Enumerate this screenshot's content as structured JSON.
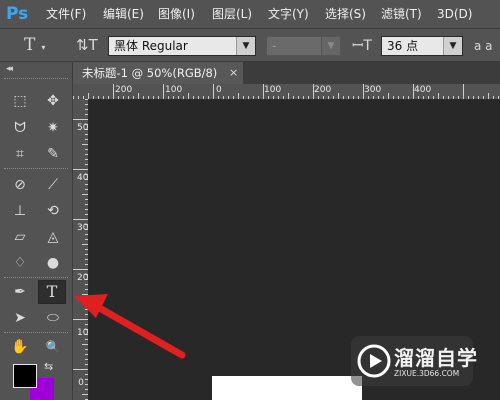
{
  "app": {
    "logo": "Ps",
    "menus": [
      "文件(F)",
      "编辑(E)",
      "图像(I)",
      "图层(L)",
      "文字(Y)",
      "选择(S)",
      "滤镜(T)",
      "3D(D)"
    ]
  },
  "options_bar": {
    "tool_icon": "text-tool-icon",
    "orientation_icon": "text-orientation-icon",
    "font_family": "黑体 Regular",
    "font_style": "-",
    "font_size_icon": "font-size-icon",
    "font_size": "36 点",
    "antialias_label": "a a"
  },
  "toolbar": {
    "collapse_glyph": "◂◂",
    "tools": [
      {
        "name": "rectangular-marquee-tool",
        "glyph": "⬚",
        "active": false
      },
      {
        "name": "move-tool",
        "glyph": "✥",
        "active": false
      },
      {
        "name": "lasso-tool",
        "glyph": "ᗢ",
        "active": false
      },
      {
        "name": "magic-wand-tool",
        "glyph": "✷",
        "active": false
      },
      {
        "name": "crop-tool",
        "glyph": "⌗",
        "active": false
      },
      {
        "name": "eyedropper-tool",
        "glyph": "✎",
        "active": false
      },
      {
        "name": "spot-healing-brush-tool",
        "glyph": "⊘",
        "active": false
      },
      {
        "name": "brush-tool",
        "glyph": "⟋",
        "active": false
      },
      {
        "name": "clone-stamp-tool",
        "glyph": "⊥",
        "active": false
      },
      {
        "name": "history-brush-tool",
        "glyph": "⟲",
        "active": false
      },
      {
        "name": "eraser-tool",
        "glyph": "▱",
        "active": false
      },
      {
        "name": "paint-bucket-tool",
        "glyph": "◬",
        "active": false
      },
      {
        "name": "blur-tool",
        "glyph": "♢",
        "active": false
      },
      {
        "name": "dodge-tool",
        "glyph": "●",
        "active": false
      },
      {
        "name": "pen-tool",
        "glyph": "✒",
        "active": false
      },
      {
        "name": "type-tool",
        "glyph": "T",
        "active": true
      },
      {
        "name": "path-selection-tool",
        "glyph": "➤",
        "active": false
      },
      {
        "name": "ellipse-tool",
        "glyph": "⬭",
        "active": false
      },
      {
        "name": "hand-tool",
        "glyph": "✋",
        "active": false
      },
      {
        "name": "zoom-tool",
        "glyph": "🔍",
        "active": false
      }
    ],
    "foreground_color": "#000000",
    "background_color": "#a000d8"
  },
  "document": {
    "tab_title": "未标题-1 @ 50%(RGB/8)",
    "close_glyph": "×",
    "h_ruler_labels": [
      "200",
      "100",
      "0",
      "100",
      "200",
      "300",
      "400"
    ],
    "v_ruler_labels": [
      "500",
      "400",
      "300",
      "200",
      "100",
      "0"
    ]
  },
  "watermark": {
    "title": "溜溜自学",
    "url": "ZIXUE.3D66.COM"
  },
  "annotation": {
    "arrow_color": "#e02020"
  }
}
